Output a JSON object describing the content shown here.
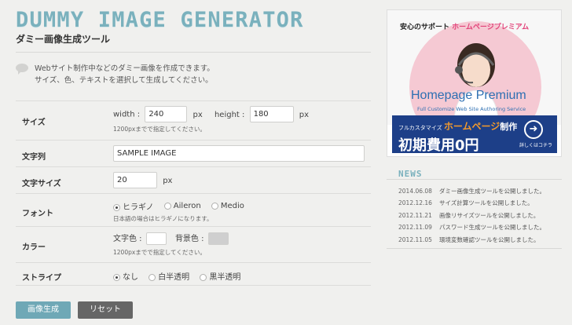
{
  "header": {
    "logo": "DUMMY IMAGE GENERATOR",
    "subtitle": "ダミー画像生成ツール"
  },
  "intro": {
    "line1": "Webサイト制作中などのダミー画像を作成できます。",
    "line2": "サイズ、色、テキストを選択して生成してください。"
  },
  "form": {
    "size": {
      "label": "サイズ",
      "width_label": "width :",
      "width_value": "240",
      "height_label": "height :",
      "height_value": "180",
      "unit": "px",
      "note": "1200pxまでで指定してください。"
    },
    "text": {
      "label": "文字列",
      "value": "SAMPLE IMAGE"
    },
    "font_size": {
      "label": "文字サイズ",
      "value": "20",
      "unit": "px"
    },
    "font": {
      "label": "フォント",
      "options": [
        "ヒラギノ",
        "Aileron",
        "Medio"
      ],
      "selected": "ヒラギノ",
      "note": "日本語の場合はヒラギノになります。"
    },
    "color": {
      "label": "カラー",
      "text_color_label": "文字色 :",
      "bg_color_label": "背景色 :",
      "text_color": "#ffffff",
      "bg_color": "#cccccc",
      "note": "1200pxまでで指定してください。"
    },
    "stripe": {
      "label": "ストライプ",
      "options": [
        "なし",
        "白半透明",
        "黒半透明"
      ],
      "selected": "なし"
    }
  },
  "buttons": {
    "generate": "画像生成",
    "reset": "リセット"
  },
  "ad": {
    "line1_a": "安心のサポート",
    "line1_b": "ホームページプレミアム",
    "brand": "Homepage Premium",
    "brand_sub": "Full Customize Web Site Authoring Service",
    "band_line1_a": "フルカスタマイズ",
    "band_line1_b": "ホームページ",
    "band_line1_c": "制作",
    "band_line2": "初期費用0円",
    "more": "詳しくはコチラ"
  },
  "news": {
    "title": "NEWS",
    "items": [
      {
        "date": "2014.06.08",
        "text": "ダミー画像生成ツールを公開しました。"
      },
      {
        "date": "2012.12.16",
        "text": "サイズ計算ツールを公開しました。"
      },
      {
        "date": "2012.11.21",
        "text": "画像リサイズツールを公開しました。"
      },
      {
        "date": "2012.11.09",
        "text": "パスワード生成ツールを公開しました。"
      },
      {
        "date": "2012.11.05",
        "text": "環境変数確認ツールを公開しました。"
      }
    ]
  },
  "colors": {
    "accent": "#7ab1bd",
    "generate_button": "#6fa8b6",
    "reset_button": "#666666"
  }
}
